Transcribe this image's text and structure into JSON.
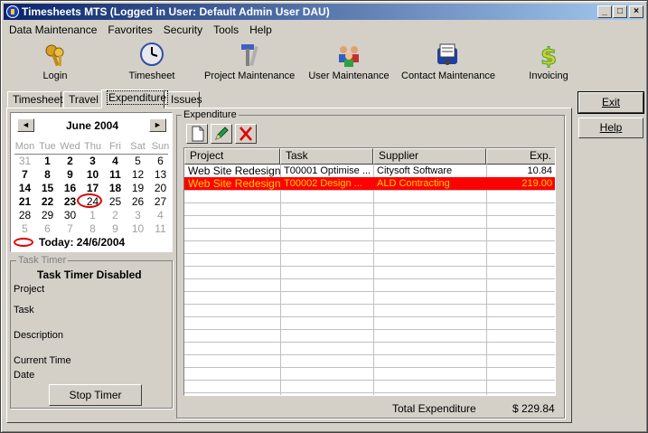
{
  "window": {
    "title": "Timesheets MTS (Logged in User: Default Admin User DAU)"
  },
  "menu": [
    "Data Maintenance",
    "Favorites",
    "Security",
    "Tools",
    "Help"
  ],
  "toolbar": [
    {
      "label": "Login",
      "icon": "keys-icon"
    },
    {
      "label": "Timesheet",
      "icon": "clock-icon"
    },
    {
      "label": "Project Maintenance",
      "icon": "tools-icon"
    },
    {
      "label": "User Maintenance",
      "icon": "users-icon"
    },
    {
      "label": "Contact Maintenance",
      "icon": "rolodex-icon"
    },
    {
      "label": "Invoicing",
      "icon": "dollar-icon"
    }
  ],
  "tabs": [
    "Timesheet",
    "Travel",
    "Expenditure",
    "Issues"
  ],
  "side_buttons": {
    "exit": "Exit",
    "help": "Help"
  },
  "calendar": {
    "month": "June 2004",
    "dow": [
      "Mon",
      "Tue",
      "Wed",
      "Thu",
      "Fri",
      "Sat",
      "Sun"
    ],
    "weeks": [
      [
        "31",
        "1",
        "2",
        "3",
        "4",
        "5",
        "6"
      ],
      [
        "7",
        "8",
        "9",
        "10",
        "11",
        "12",
        "13"
      ],
      [
        "14",
        "15",
        "16",
        "17",
        "18",
        "19",
        "20"
      ],
      [
        "21",
        "22",
        "23",
        "24",
        "25",
        "26",
        "27"
      ],
      [
        "28",
        "29",
        "30",
        "1",
        "2",
        "3",
        "4"
      ],
      [
        "5",
        "6",
        "7",
        "8",
        "9",
        "10",
        "11"
      ]
    ],
    "today_label": "Today: 24/6/2004"
  },
  "task_timer": {
    "group": "Task Timer",
    "status": "Task Timer Disabled",
    "project": "Project",
    "task": "Task",
    "description": "Description",
    "current_time": "Current Time",
    "date": "Date",
    "stop": "Stop Timer"
  },
  "expenditure": {
    "group": "Expenditure",
    "columns": [
      "Project",
      "Task",
      "Supplier",
      "Exp."
    ],
    "rows": [
      {
        "project": "Web Site Redesign",
        "task": "T00001 Optimise ...",
        "supplier": "Citysoft Software",
        "exp": "10.84",
        "selected": false
      },
      {
        "project": "Web Site Redesign",
        "task": "T00002 Design ...",
        "supplier": "ALD Contracting",
        "exp": "219.00",
        "selected": true
      }
    ],
    "total_label": "Total Expenditure",
    "total_value": "$ 229.84"
  }
}
